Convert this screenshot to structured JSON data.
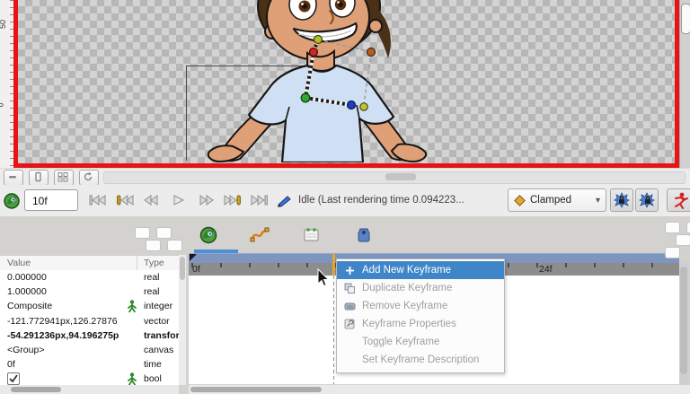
{
  "canvas": {
    "v_ruler_labels": [
      "50",
      "0"
    ],
    "icons": [
      "minimize-icon",
      "page-icon",
      "grid-icon",
      "refresh-icon"
    ]
  },
  "toolbar": {
    "time_value": "10f",
    "status": "Idle (Last rendering time 0.094223...",
    "interpolation_label": "Clamped",
    "dropdown_arrow": "▾",
    "icons": [
      "synfig-logo-icon",
      "seek-begin-icon",
      "seek-prev-keyframe-icon",
      "seek-prev-frame-icon",
      "play-icon",
      "seek-next-frame-icon",
      "seek-next-keyframe-icon",
      "seek-end-icon",
      "render-preview-icon",
      "interpolation-diamond-icon",
      "keyframe-lock-past-icon",
      "keyframe-lock-future-icon",
      "animate-mode-icon"
    ]
  },
  "params": {
    "headers": [
      "Value",
      "Type"
    ],
    "rows": [
      {
        "value": "0.000000",
        "type": "real"
      },
      {
        "value": "1.000000",
        "type": "real"
      },
      {
        "value": "Composite",
        "type": "integer"
      },
      {
        "value": "-121.772941px,126.27876",
        "type": "vector"
      },
      {
        "value": "-54.291236px,94.196275p",
        "type": "transformation"
      },
      {
        "value": "<Group>",
        "type": "canvas"
      },
      {
        "value": "0f",
        "type": "time"
      },
      {
        "value": "",
        "type": "bool"
      }
    ]
  },
  "timetrack": {
    "label_start": "0f",
    "label_end": "24f",
    "tab_icons": [
      "synfig-parameters-icon",
      "curves-icon",
      "timetrack-board-icon",
      "keyframes-tag-icon"
    ],
    "colors": {
      "timebar": "#7d95bf",
      "ruler": "#8d8d8d",
      "tab_underline": "#4d90d4",
      "cursor": "#e8a62a"
    }
  },
  "context_menu": {
    "items": [
      {
        "label": "Add New Keyframe",
        "icon": "plus-icon",
        "enabled": true,
        "highlighted": true
      },
      {
        "label": "Duplicate Keyframe",
        "icon": "duplicate-icon",
        "enabled": false
      },
      {
        "label": "Remove Keyframe",
        "icon": "remove-icon",
        "enabled": false
      },
      {
        "label": "Keyframe Properties",
        "icon": "properties-icon",
        "enabled": false
      },
      {
        "label": "Toggle Keyframe",
        "icon": "",
        "enabled": false
      },
      {
        "label": "Set Keyframe Description",
        "icon": "",
        "enabled": false
      }
    ],
    "highlight_color": "#3f86c9"
  },
  "colors": {
    "canvas_frame": "#e81414",
    "selection_highlight": "#3f86c9",
    "shirt": "#cfe0f4",
    "skin": "#dfa077",
    "hair": "#4a3015"
  }
}
